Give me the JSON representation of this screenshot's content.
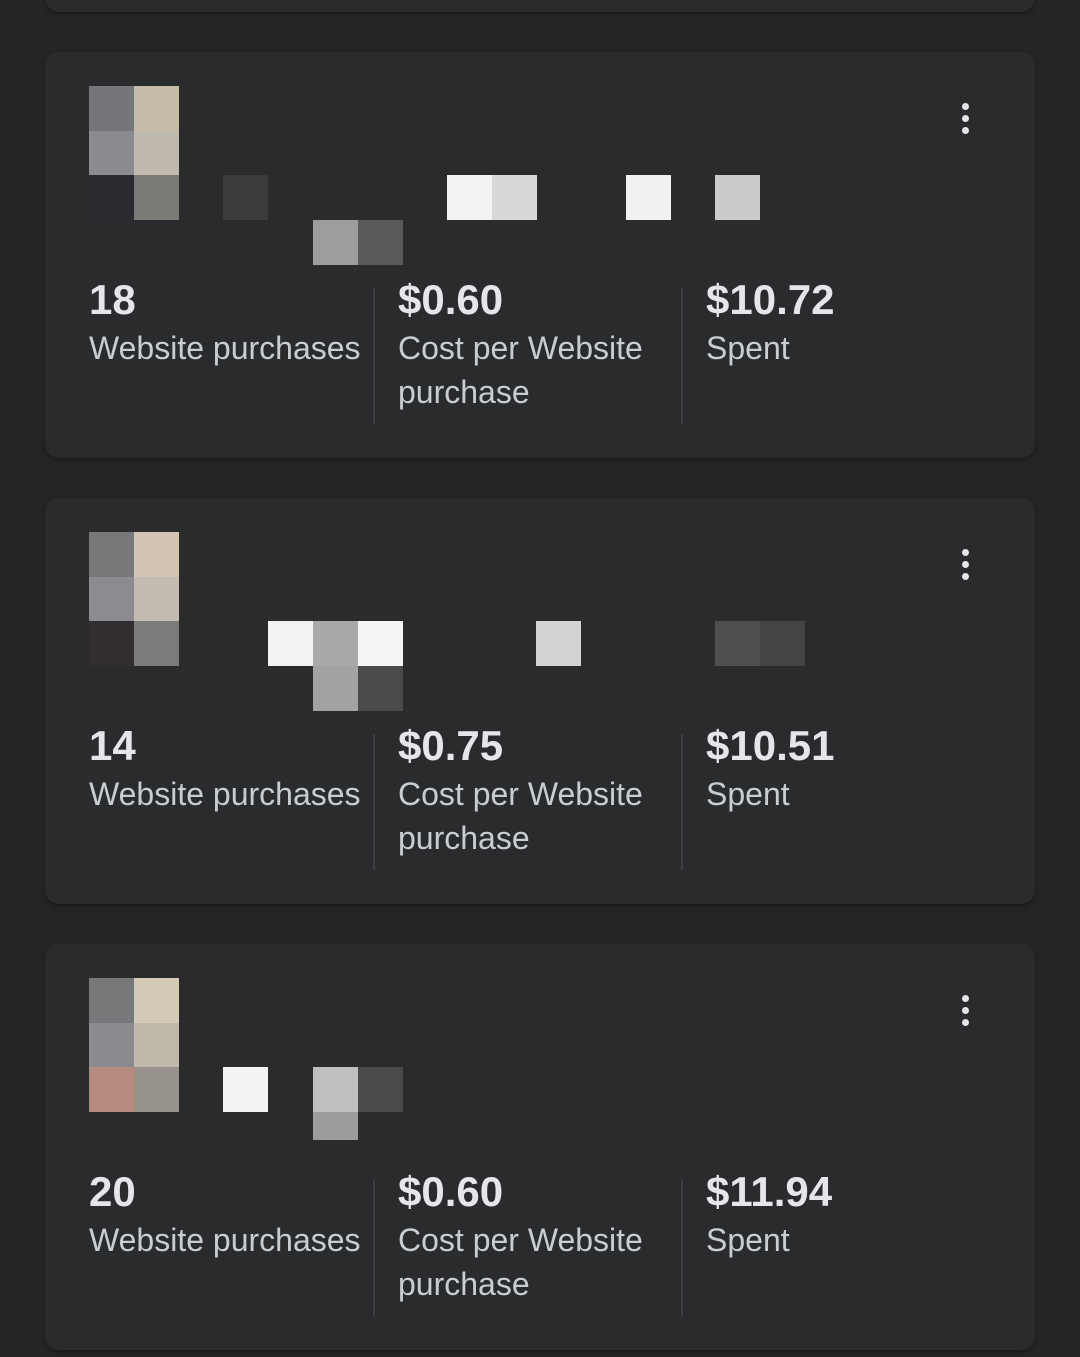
{
  "colors": {
    "background": "#242527",
    "card": "#2a2b2d",
    "text_primary": "#e4e6eb",
    "text_secondary": "#c9ccd1",
    "divider": "#3d3e41"
  },
  "icons": {
    "more": "more-vertical-icon"
  },
  "ads": [
    {
      "metrics": [
        {
          "value": "18",
          "label": "Website purchases"
        },
        {
          "value": "$0.60",
          "label": "Cost per Website purchase"
        },
        {
          "value": "$10.72",
          "label": "Spent"
        }
      ]
    },
    {
      "metrics": [
        {
          "value": "14",
          "label": "Website purchases"
        },
        {
          "value": "$0.75",
          "label": "Cost per Website purchase"
        },
        {
          "value": "$10.51",
          "label": "Spent"
        }
      ]
    },
    {
      "metrics": [
        {
          "value": "20",
          "label": "Website purchases"
        },
        {
          "value": "$0.60",
          "label": "Cost per Website purchase"
        },
        {
          "value": "$11.94",
          "label": "Spent"
        }
      ]
    }
  ]
}
